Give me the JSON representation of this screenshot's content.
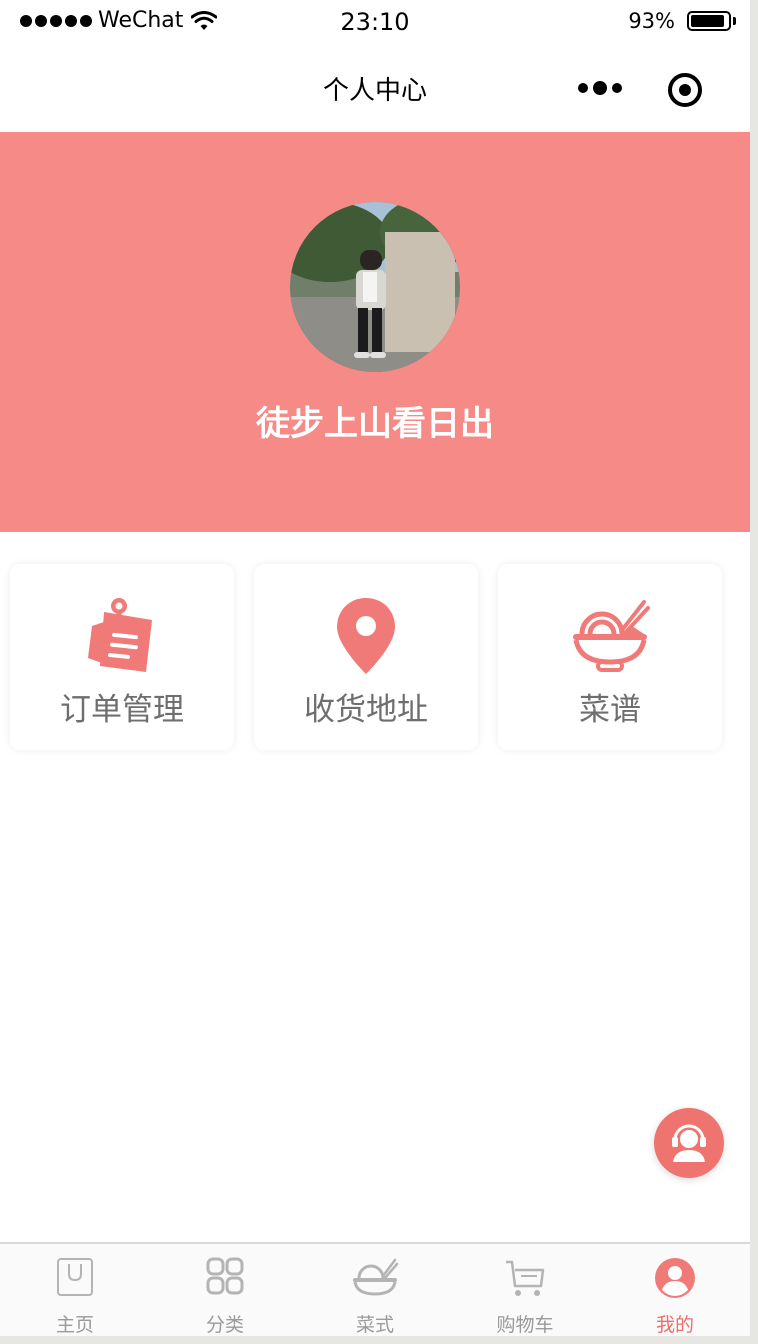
{
  "status_bar": {
    "carrier": "WeChat",
    "time": "23:10",
    "battery_percent": "93%",
    "battery_level": 0.93,
    "signal_dots": 5
  },
  "nav": {
    "title": "个人中心",
    "icons": [
      "more-dots-icon",
      "target-circle-icon"
    ]
  },
  "profile": {
    "username": "徒步上山看日出",
    "header_color": "#f58a87"
  },
  "features": [
    {
      "label": "订单管理",
      "icon": "order-notes-icon"
    },
    {
      "label": "收货地址",
      "icon": "location-pin-icon"
    },
    {
      "label": "菜谱",
      "icon": "noodle-bowl-icon"
    }
  ],
  "service_button": {
    "icon": "customer-service-icon"
  },
  "tab_bar": {
    "tabs": [
      {
        "label": "主页",
        "icon": "home-bag-icon",
        "active": false
      },
      {
        "label": "分类",
        "icon": "category-grid-icon",
        "active": false
      },
      {
        "label": "菜式",
        "icon": "dish-bowl-icon",
        "active": false
      },
      {
        "label": "购物车",
        "icon": "cart-icon",
        "active": false
      },
      {
        "label": "我的",
        "icon": "profile-icon",
        "active": true
      }
    ],
    "active_color": "#ef6e6b",
    "inactive_color": "#9a9a9a"
  },
  "colors": {
    "accent": "#f07a78"
  }
}
